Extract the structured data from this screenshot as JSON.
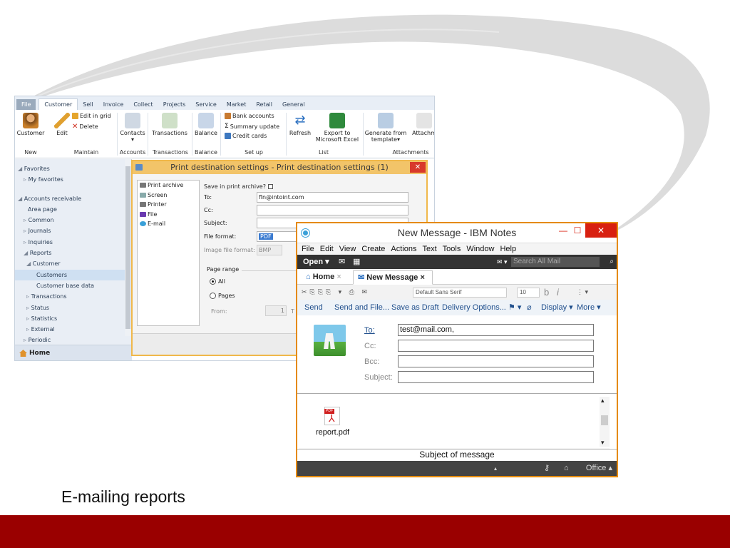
{
  "caption": "E-mailing reports",
  "ax": {
    "tabs": [
      "File",
      "Customer",
      "Sell",
      "Invoice",
      "Collect",
      "Projects",
      "Service",
      "Market",
      "Retail",
      "General"
    ],
    "ribbon": {
      "customer": "Customer",
      "edit": "Edit",
      "edit_in_grid": "Edit in grid",
      "delete": "Delete",
      "contacts": "Contacts",
      "transactions": "Transactions",
      "balance": "Balance",
      "bank_accounts": "Bank accounts",
      "summary_update": "Summary update",
      "credit_cards": "Credit cards",
      "refresh": "Refresh",
      "export_excel_1": "Export to",
      "export_excel_2": "Microsoft Excel",
      "generate_1": "Generate from",
      "generate_2": "template",
      "attach": "Attachm",
      "groups": [
        "New",
        "Maintain",
        "Accounts",
        "Transactions",
        "Balance",
        "Set up",
        "List",
        "Attachments"
      ]
    },
    "nav": {
      "items": [
        {
          "label": "Favorites",
          "prefix": "◢ ",
          "indent": 4
        },
        {
          "label": "My favorites",
          "prefix": "▹ ",
          "indent": 12
        },
        {
          "label": "",
          "prefix": "",
          "indent": 0,
          "gap": true
        },
        {
          "label": "Accounts receivable",
          "prefix": "◢ ",
          "indent": 4
        },
        {
          "label": "Area page",
          "prefix": "",
          "indent": 18
        },
        {
          "label": "Common",
          "prefix": "▹ ",
          "indent": 12
        },
        {
          "label": "Journals",
          "prefix": "▹ ",
          "indent": 12
        },
        {
          "label": "Inquiries",
          "prefix": "▹ ",
          "indent": 12
        },
        {
          "label": "Reports",
          "prefix": "◢ ",
          "indent": 12
        },
        {
          "label": "Customer",
          "prefix": "◢ ",
          "indent": 16
        },
        {
          "label": "Customers",
          "prefix": "",
          "indent": 30,
          "selected": true
        },
        {
          "label": "Customer base data",
          "prefix": "",
          "indent": 30
        },
        {
          "label": "Transactions",
          "prefix": "▹ ",
          "indent": 16
        },
        {
          "label": "Status",
          "prefix": "▹ ",
          "indent": 16
        },
        {
          "label": "Statistics",
          "prefix": "▹ ",
          "indent": 16
        },
        {
          "label": "External",
          "prefix": "▹ ",
          "indent": 16
        },
        {
          "label": "Periodic",
          "prefix": "▹ ",
          "indent": 12
        }
      ],
      "home": "Home"
    }
  },
  "dialog": {
    "title": "Print destination settings - Print destination settings (1)",
    "destinations": [
      "Print archive",
      "Screen",
      "Printer",
      "File",
      "E-mail"
    ],
    "save_archive": "Save in print archive?",
    "to_label": "To:",
    "to_value": "fln@intoint.com",
    "cc_label": "Cc:",
    "subject_label": "Subject:",
    "file_format_label": "File format:",
    "file_format_value": "PDF",
    "image_format_label": "Image file format:",
    "image_format_value": "BMP",
    "page_range": "Page range",
    "all": "All",
    "pages": "Pages",
    "from": "From:",
    "from_value": "1",
    "to_short": "T"
  },
  "notes": {
    "title": "New Message - IBM Notes",
    "menu": [
      "File",
      "Edit",
      "View",
      "Create",
      "Actions",
      "Text",
      "Tools",
      "Window",
      "Help"
    ],
    "open": "Open ▾",
    "search_placeholder": "Search All Mail",
    "tab_home": "Home",
    "tab_new": "New Message",
    "font": "Default Sans Serif",
    "font_size": "10",
    "actions": [
      "Send",
      "Send and File...",
      "Save as Draft",
      "Delivery Options...",
      "Display ▾",
      "More ▾"
    ],
    "to_label": "To:",
    "to_value": "test@mail.com,",
    "cc_label": "Cc:",
    "bcc_label": "Bcc:",
    "subject_label": "Subject:",
    "attachment": "report.pdf",
    "subject_bar": "Subject of message",
    "status_right": "Office ▴"
  }
}
